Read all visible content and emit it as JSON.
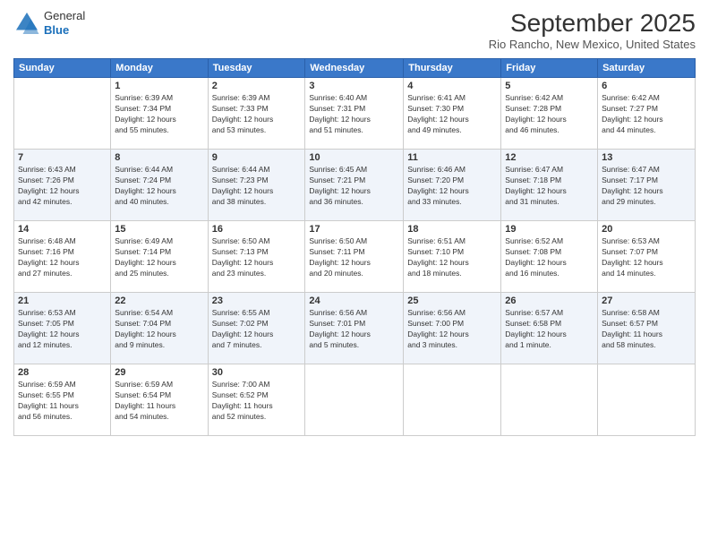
{
  "header": {
    "logo": {
      "general": "General",
      "blue": "Blue"
    },
    "title": "September 2025",
    "location": "Rio Rancho, New Mexico, United States"
  },
  "calendar": {
    "days_of_week": [
      "Sunday",
      "Monday",
      "Tuesday",
      "Wednesday",
      "Thursday",
      "Friday",
      "Saturday"
    ],
    "weeks": [
      [
        {
          "day": "",
          "info": ""
        },
        {
          "day": "1",
          "info": "Sunrise: 6:39 AM\nSunset: 7:34 PM\nDaylight: 12 hours\nand 55 minutes."
        },
        {
          "day": "2",
          "info": "Sunrise: 6:39 AM\nSunset: 7:33 PM\nDaylight: 12 hours\nand 53 minutes."
        },
        {
          "day": "3",
          "info": "Sunrise: 6:40 AM\nSunset: 7:31 PM\nDaylight: 12 hours\nand 51 minutes."
        },
        {
          "day": "4",
          "info": "Sunrise: 6:41 AM\nSunset: 7:30 PM\nDaylight: 12 hours\nand 49 minutes."
        },
        {
          "day": "5",
          "info": "Sunrise: 6:42 AM\nSunset: 7:28 PM\nDaylight: 12 hours\nand 46 minutes."
        },
        {
          "day": "6",
          "info": "Sunrise: 6:42 AM\nSunset: 7:27 PM\nDaylight: 12 hours\nand 44 minutes."
        }
      ],
      [
        {
          "day": "7",
          "info": "Sunrise: 6:43 AM\nSunset: 7:26 PM\nDaylight: 12 hours\nand 42 minutes."
        },
        {
          "day": "8",
          "info": "Sunrise: 6:44 AM\nSunset: 7:24 PM\nDaylight: 12 hours\nand 40 minutes."
        },
        {
          "day": "9",
          "info": "Sunrise: 6:44 AM\nSunset: 7:23 PM\nDaylight: 12 hours\nand 38 minutes."
        },
        {
          "day": "10",
          "info": "Sunrise: 6:45 AM\nSunset: 7:21 PM\nDaylight: 12 hours\nand 36 minutes."
        },
        {
          "day": "11",
          "info": "Sunrise: 6:46 AM\nSunset: 7:20 PM\nDaylight: 12 hours\nand 33 minutes."
        },
        {
          "day": "12",
          "info": "Sunrise: 6:47 AM\nSunset: 7:18 PM\nDaylight: 12 hours\nand 31 minutes."
        },
        {
          "day": "13",
          "info": "Sunrise: 6:47 AM\nSunset: 7:17 PM\nDaylight: 12 hours\nand 29 minutes."
        }
      ],
      [
        {
          "day": "14",
          "info": "Sunrise: 6:48 AM\nSunset: 7:16 PM\nDaylight: 12 hours\nand 27 minutes."
        },
        {
          "day": "15",
          "info": "Sunrise: 6:49 AM\nSunset: 7:14 PM\nDaylight: 12 hours\nand 25 minutes."
        },
        {
          "day": "16",
          "info": "Sunrise: 6:50 AM\nSunset: 7:13 PM\nDaylight: 12 hours\nand 23 minutes."
        },
        {
          "day": "17",
          "info": "Sunrise: 6:50 AM\nSunset: 7:11 PM\nDaylight: 12 hours\nand 20 minutes."
        },
        {
          "day": "18",
          "info": "Sunrise: 6:51 AM\nSunset: 7:10 PM\nDaylight: 12 hours\nand 18 minutes."
        },
        {
          "day": "19",
          "info": "Sunrise: 6:52 AM\nSunset: 7:08 PM\nDaylight: 12 hours\nand 16 minutes."
        },
        {
          "day": "20",
          "info": "Sunrise: 6:53 AM\nSunset: 7:07 PM\nDaylight: 12 hours\nand 14 minutes."
        }
      ],
      [
        {
          "day": "21",
          "info": "Sunrise: 6:53 AM\nSunset: 7:05 PM\nDaylight: 12 hours\nand 12 minutes."
        },
        {
          "day": "22",
          "info": "Sunrise: 6:54 AM\nSunset: 7:04 PM\nDaylight: 12 hours\nand 9 minutes."
        },
        {
          "day": "23",
          "info": "Sunrise: 6:55 AM\nSunset: 7:02 PM\nDaylight: 12 hours\nand 7 minutes."
        },
        {
          "day": "24",
          "info": "Sunrise: 6:56 AM\nSunset: 7:01 PM\nDaylight: 12 hours\nand 5 minutes."
        },
        {
          "day": "25",
          "info": "Sunrise: 6:56 AM\nSunset: 7:00 PM\nDaylight: 12 hours\nand 3 minutes."
        },
        {
          "day": "26",
          "info": "Sunrise: 6:57 AM\nSunset: 6:58 PM\nDaylight: 12 hours\nand 1 minute."
        },
        {
          "day": "27",
          "info": "Sunrise: 6:58 AM\nSunset: 6:57 PM\nDaylight: 11 hours\nand 58 minutes."
        }
      ],
      [
        {
          "day": "28",
          "info": "Sunrise: 6:59 AM\nSunset: 6:55 PM\nDaylight: 11 hours\nand 56 minutes."
        },
        {
          "day": "29",
          "info": "Sunrise: 6:59 AM\nSunset: 6:54 PM\nDaylight: 11 hours\nand 54 minutes."
        },
        {
          "day": "30",
          "info": "Sunrise: 7:00 AM\nSunset: 6:52 PM\nDaylight: 11 hours\nand 52 minutes."
        },
        {
          "day": "",
          "info": ""
        },
        {
          "day": "",
          "info": ""
        },
        {
          "day": "",
          "info": ""
        },
        {
          "day": "",
          "info": ""
        }
      ]
    ]
  }
}
